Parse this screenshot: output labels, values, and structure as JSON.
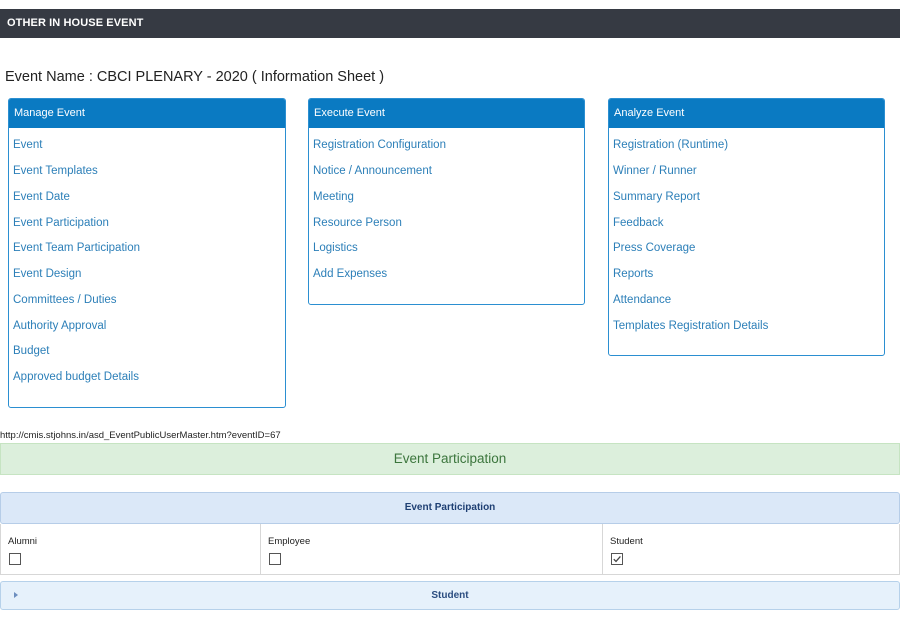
{
  "header": {
    "title": "OTHER IN HOUSE EVENT"
  },
  "event": {
    "name_line": "Event Name : CBCI PLENARY - 2020 ( Information Sheet )"
  },
  "manage": {
    "title": "Manage Event",
    "items": [
      "Event",
      "Event Templates",
      "Event Date",
      "Event Participation",
      "Event Team Participation",
      "Event Design",
      "Committees / Duties",
      "Authority Approval",
      "Budget",
      "Approved budget Details"
    ]
  },
  "execute": {
    "title": "Execute Event",
    "items": [
      "Registration Configuration",
      "Notice / Announcement",
      "Meeting",
      "Resource Person",
      "Logistics",
      "Add Expenses"
    ]
  },
  "analyze": {
    "title": "Analyze Event",
    "items": [
      "Registration (Runtime)",
      "Winner / Runner",
      "Summary Report",
      "Feedback",
      "Press Coverage",
      "Reports",
      "Attendance",
      "Templates Registration Details"
    ]
  },
  "url_text": "http://cmis.stjohns.in/asd_EventPublicUserMaster.htm?eventID=67",
  "participation_banner": "Event Participation",
  "participation_table": {
    "header": "Event Participation",
    "options": [
      {
        "label": "Alumni",
        "checked": false
      },
      {
        "label": "Employee",
        "checked": false
      },
      {
        "label": "Student",
        "checked": true
      }
    ]
  },
  "student_section": {
    "label": "Student",
    "expanded": false
  }
}
